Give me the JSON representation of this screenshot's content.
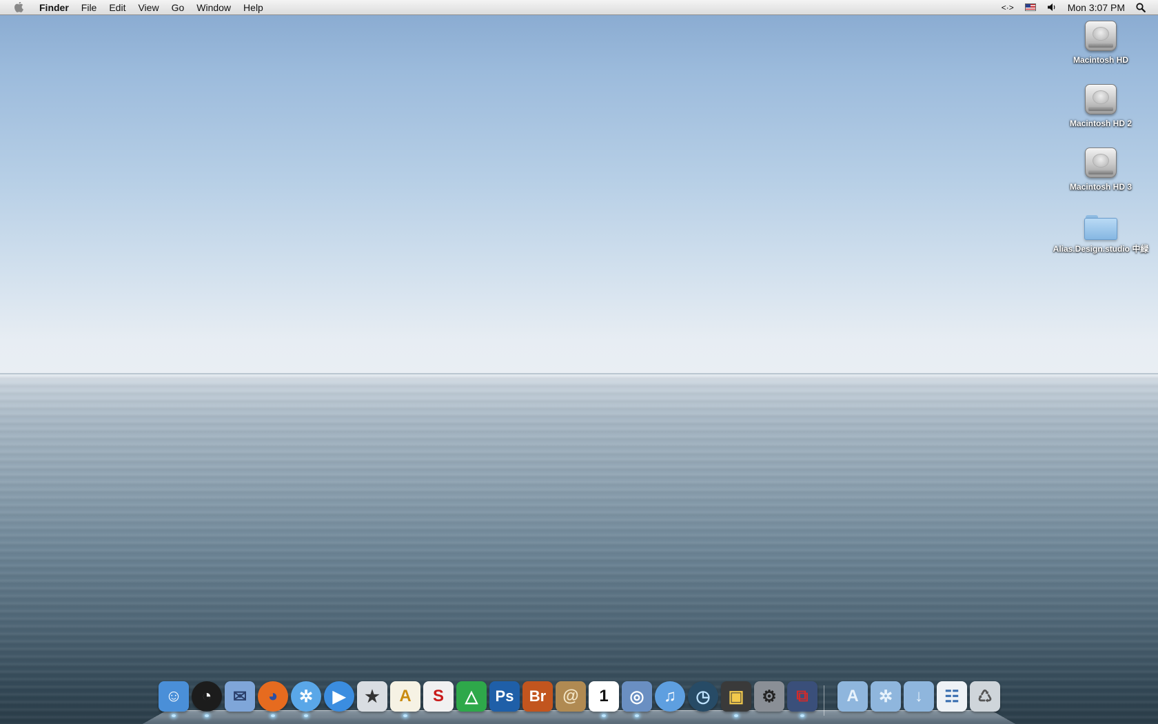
{
  "menubar": {
    "app_name": "Finder",
    "menus": [
      "File",
      "Edit",
      "View",
      "Go",
      "Window",
      "Help"
    ],
    "status": {
      "code_glyph": "<·>",
      "input_flag": "us-flag-icon",
      "volume_icon": "speaker-icon",
      "clock": "Mon 3:07 PM",
      "search_icon": "spotlight-icon"
    }
  },
  "desktop_icons": [
    {
      "type": "drive",
      "label": "Macintosh HD"
    },
    {
      "type": "drive",
      "label": "Macintosh HD 2"
    },
    {
      "type": "drive",
      "label": "Macintosh HD 3"
    },
    {
      "type": "folder",
      "label": "Alias.Design.studio 中緑"
    }
  ],
  "dock": {
    "apps": [
      {
        "name": "finder-icon",
        "glyph": "☺",
        "bg": "#4a8fd8",
        "fg": "#ffffff",
        "shape": "square"
      },
      {
        "name": "dashboard-icon",
        "glyph": "◔",
        "bg": "#1c1c1c",
        "fg": "#ffffff",
        "shape": "round"
      },
      {
        "name": "mail-icon",
        "glyph": "✉",
        "bg": "#7fa6d9",
        "fg": "#2a3f6b",
        "shape": "square"
      },
      {
        "name": "firefox-icon",
        "glyph": "◕",
        "bg": "#e66b1f",
        "fg": "#2b4fa3",
        "shape": "round"
      },
      {
        "name": "safari-icon",
        "glyph": "✲",
        "bg": "#5aa7e8",
        "fg": "#ffffff",
        "shape": "round"
      },
      {
        "name": "ichat-icon",
        "glyph": "▶",
        "bg": "#3b8de0",
        "fg": "#ffffff",
        "shape": "round"
      },
      {
        "name": "zbrush-icon",
        "glyph": "★",
        "bg": "#d9dde2",
        "fg": "#333333",
        "shape": "square"
      },
      {
        "name": "autocad-icon",
        "glyph": "A",
        "bg": "#f6f2e4",
        "fg": "#c98b10",
        "shape": "square"
      },
      {
        "name": "sketchbook-icon",
        "glyph": "S",
        "bg": "#f1f1f1",
        "fg": "#c81a1a",
        "shape": "square"
      },
      {
        "name": "maya-icon",
        "glyph": "△",
        "bg": "#2ea84a",
        "fg": "#ffffff",
        "shape": "square"
      },
      {
        "name": "photoshop-icon",
        "glyph": "Ps",
        "bg": "#1f5fa8",
        "fg": "#ffffff",
        "shape": "square"
      },
      {
        "name": "bridge-icon",
        "glyph": "Br",
        "bg": "#c2551e",
        "fg": "#ffffff",
        "shape": "square"
      },
      {
        "name": "address-book-icon",
        "glyph": "@",
        "bg": "#b08a52",
        "fg": "#f4e7c8",
        "shape": "square"
      },
      {
        "name": "ical-icon",
        "glyph": "1",
        "bg": "#ffffff",
        "fg": "#111111",
        "shape": "square"
      },
      {
        "name": "preview-icon",
        "glyph": "◎",
        "bg": "#6a8fc2",
        "fg": "#ffffff",
        "shape": "square"
      },
      {
        "name": "itunes-icon",
        "glyph": "♫",
        "bg": "#5e9fe0",
        "fg": "#ffffff",
        "shape": "round"
      },
      {
        "name": "time-machine-icon",
        "glyph": "◷",
        "bg": "#274b66",
        "fg": "#bfe3ff",
        "shape": "round"
      },
      {
        "name": "photo-booth-icon",
        "glyph": "▣",
        "bg": "#3a3a3a",
        "fg": "#f2c94c",
        "shape": "square"
      },
      {
        "name": "system-preferences-icon",
        "glyph": "⚙",
        "bg": "#8a8f96",
        "fg": "#222222",
        "shape": "square"
      },
      {
        "name": "vmware-icon",
        "glyph": "⧉",
        "bg": "#3a4f7a",
        "fg": "#d12b2b",
        "shape": "square"
      }
    ],
    "stacks": [
      {
        "name": "applications-stack-icon",
        "glyph": "A",
        "bg": "#8fb6dd",
        "fg": "#e8f3fc"
      },
      {
        "name": "documents-stack-icon",
        "glyph": "✲",
        "bg": "#8fb6dd",
        "fg": "#e8f3fc"
      },
      {
        "name": "downloads-stack-icon",
        "glyph": "↓",
        "bg": "#8fb6dd",
        "fg": "#e8f3fc"
      },
      {
        "name": "window-stack-icon",
        "glyph": "☷",
        "bg": "#eef2f6",
        "fg": "#3a6fb0"
      },
      {
        "name": "trash-icon",
        "glyph": "♺",
        "bg": "#cfd5da",
        "fg": "#555555"
      }
    ]
  },
  "colors": {
    "menubar_text": "#111111",
    "label_text": "#ffffff",
    "running_indicator": "#bfe6ff"
  }
}
